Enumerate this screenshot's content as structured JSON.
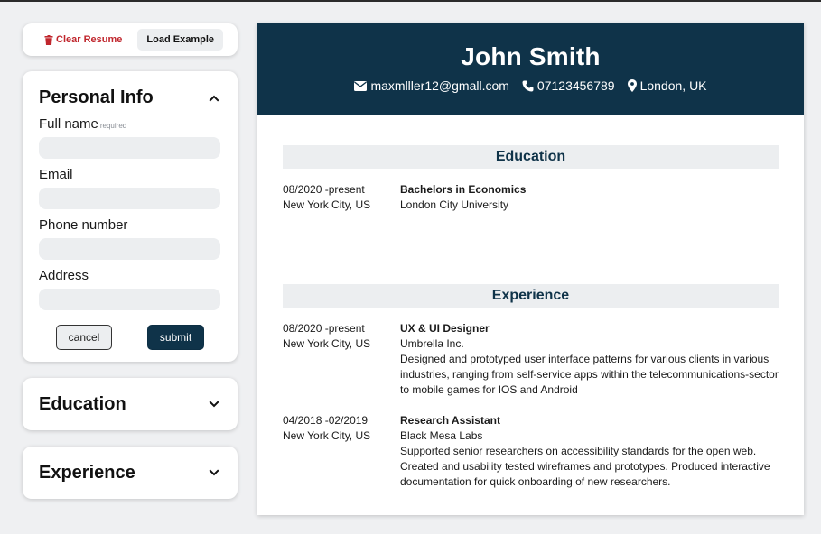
{
  "controls": {
    "clear_label": "Clear Resume",
    "load_label": "Load Example"
  },
  "personal": {
    "title": "Personal Info",
    "fields": {
      "full_name": {
        "label": "Full name",
        "hint": "required",
        "value": ""
      },
      "email": {
        "label": "Email",
        "value": ""
      },
      "phone": {
        "label": "Phone number",
        "value": ""
      },
      "address": {
        "label": "Address",
        "value": ""
      }
    },
    "cancel_label": "cancel",
    "submit_label": "submit"
  },
  "education_panel": {
    "title": "Education"
  },
  "experience_panel": {
    "title": "Experience"
  },
  "resume": {
    "name": "John Smith",
    "email": "maxmlller12@gmall.com",
    "phone": "07123456789",
    "location": "London, UK",
    "education_title": "Education",
    "education": [
      {
        "dates": "08/2020 -present",
        "location": "New York City, US",
        "degree": "Bachelors in Economics",
        "school": "London City University"
      }
    ],
    "experience_title": "Experience",
    "experience": [
      {
        "dates": "08/2020 -present",
        "location": "New York City, US",
        "role": "UX & UI Designer",
        "company": "Umbrella Inc.",
        "description": "Designed and prototyped user interface patterns for various clients in various industries, ranging from self-service apps within the telecommunications-sector to mobile games for IOS and Android"
      },
      {
        "dates": "04/2018 -02/2019",
        "location": "New York City, US",
        "role": "Research Assistant",
        "company": "Black Mesa Labs",
        "description": "Supported senior researchers on accessibility standards for the open web. Created and usability tested wireframes and prototypes. Produced interactive documentation for quick onboarding of new researchers."
      }
    ]
  },
  "colors": {
    "header_bg": "#0f3349",
    "clear_red": "#c0262d",
    "section_bar": "#eceef0"
  },
  "icons": {
    "clear": "trash-icon",
    "collapse": "chevron-up-icon",
    "expand": "chevron-down-icon",
    "email": "envelope-icon",
    "phone": "phone-icon",
    "location": "map-pin-icon"
  }
}
